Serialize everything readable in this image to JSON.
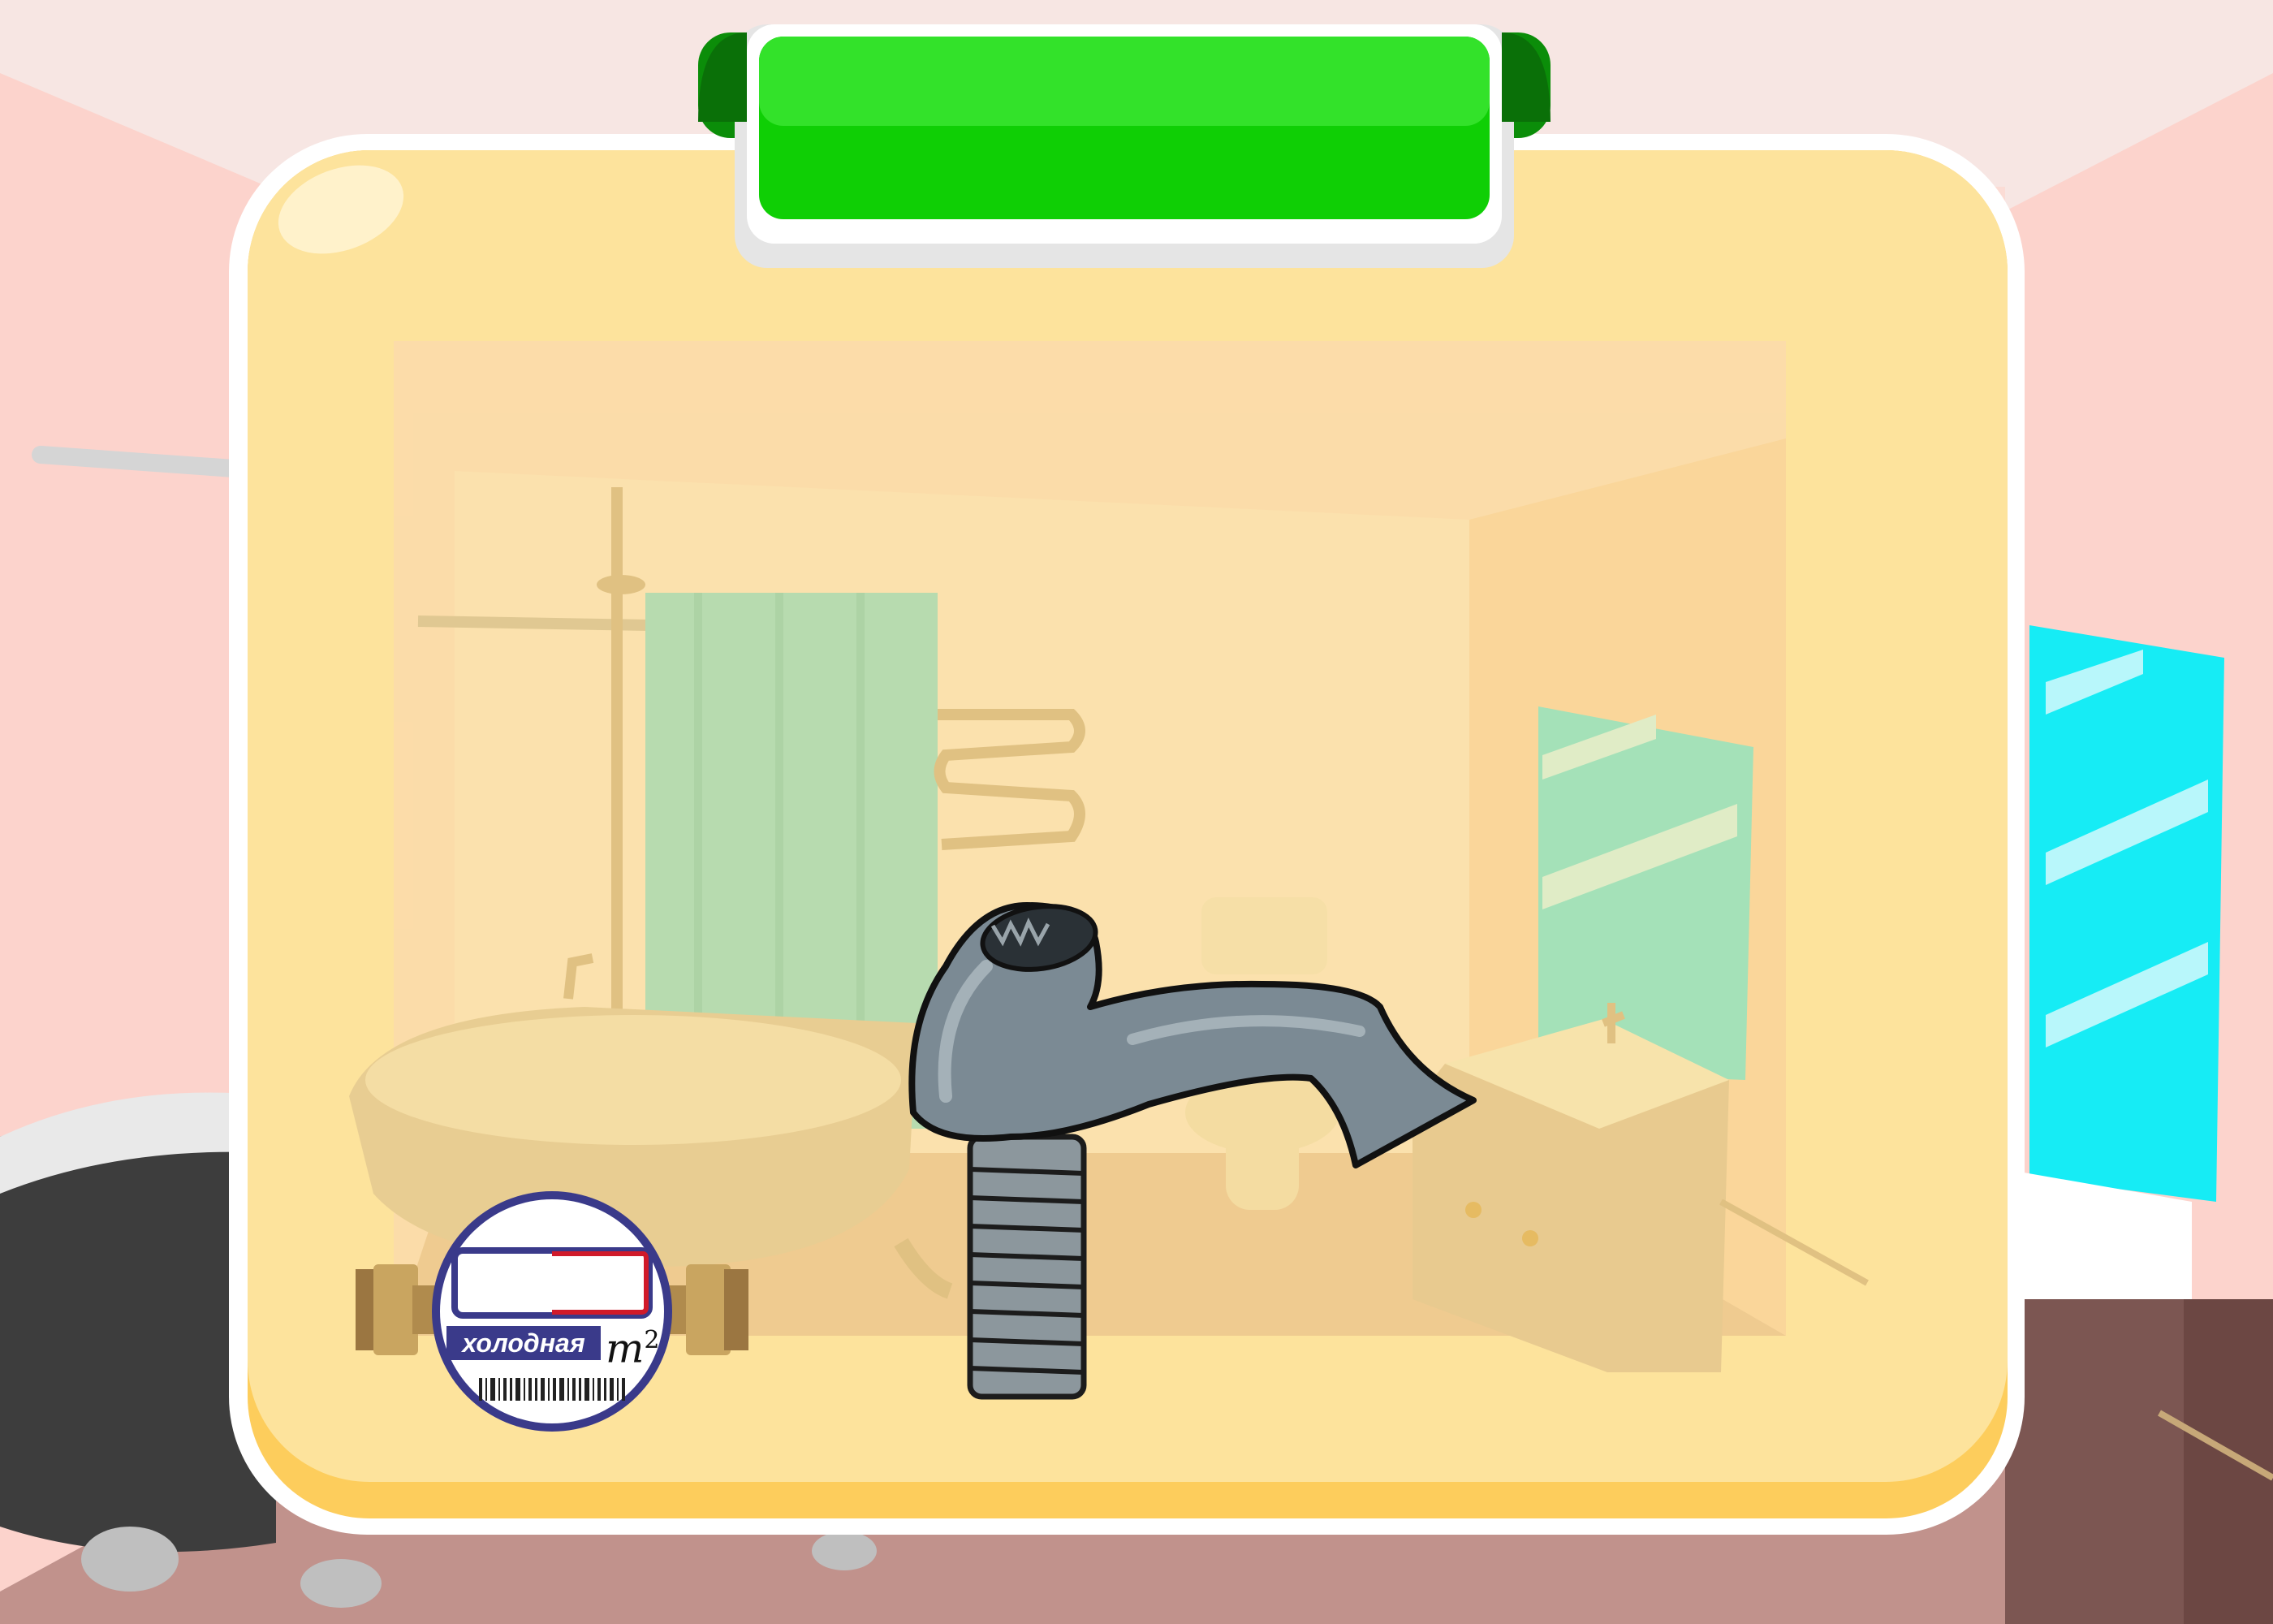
{
  "scene": {
    "colors": {
      "ceiling": "#f7e6e3",
      "wall": "#fcd3cc",
      "floor": "#c1928c",
      "panel_outer": "#ffffff",
      "panel_fill": "#fde39c",
      "title_tab": "#22dd12",
      "faucet": "#7b8a94",
      "meter_brand": "#3a3a8a"
    }
  },
  "panel": {
    "title": "",
    "items": [
      {
        "name": "water-meter",
        "icon": "water-meter-icon"
      },
      {
        "name": "faucet-spout",
        "icon": "faucet-spout-icon"
      }
    ]
  },
  "water_meter": {
    "label": "холодная",
    "unit": "m",
    "unit_power": "2"
  }
}
